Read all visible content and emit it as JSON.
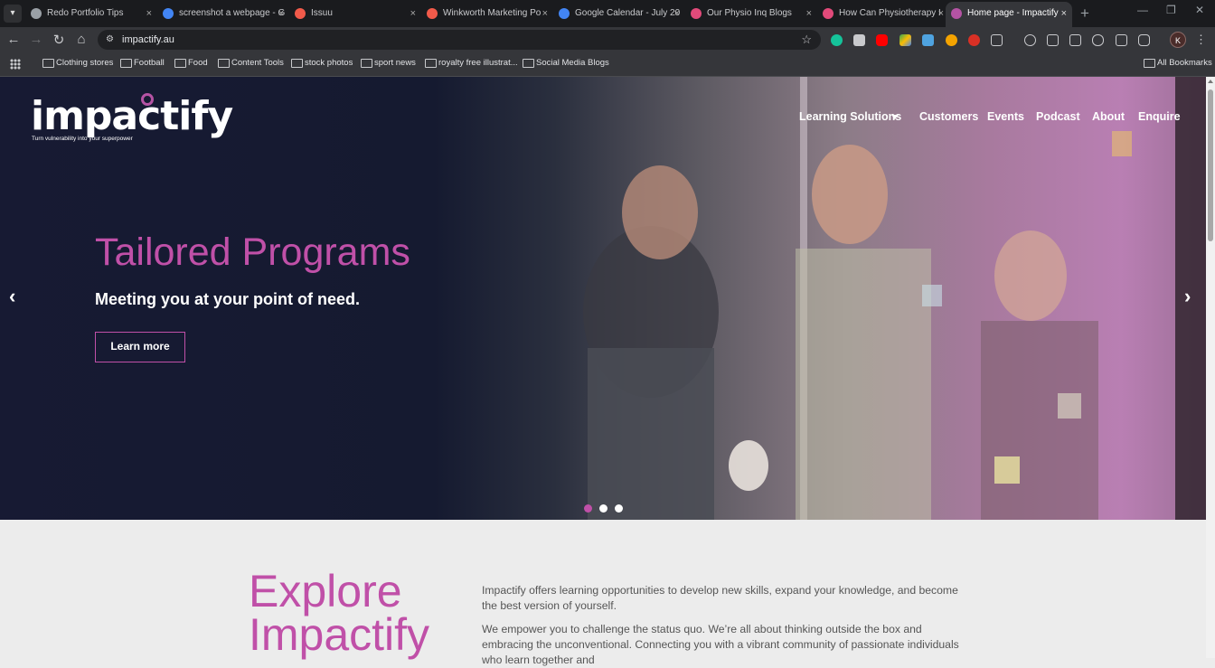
{
  "browser": {
    "tabs": [
      {
        "title": "Redo Portfolio Tips",
        "color": "#9aa0a6"
      },
      {
        "title": "screenshot a webpage - G",
        "color": "#4285f4"
      },
      {
        "title": "Issuu",
        "color": "#f15a4a"
      },
      {
        "title": "Winkworth Marketing Po",
        "color": "#f15a4a"
      },
      {
        "title": "Google Calendar - July 20",
        "color": "#4285f4"
      },
      {
        "title": "Our Physio Inq Blogs",
        "color": "#e24a7a"
      },
      {
        "title": "How Can Physiotherapy I",
        "color": "#e24a7a"
      },
      {
        "title": "Home page - Impactify",
        "color": "#b553a4"
      }
    ],
    "close_glyph": "×",
    "newtab_glyph": "+",
    "url": "impactify.au",
    "avatar_letter": "K",
    "bookmarks": [
      "Clothing stores",
      "Football",
      "Food",
      "Content Tools",
      "stock photos",
      "sport news",
      "royalty free illustrat...",
      "Social Media Blogs"
    ],
    "all_bookmarks": "All Bookmarks"
  },
  "site": {
    "logo": "impactify",
    "tagline": "Turn vulnerability into your superpower",
    "nav": [
      "Learning Solutions",
      "Customers",
      "Events",
      "Podcast",
      "About",
      "Enquire"
    ],
    "hero": {
      "headline": "Tailored Programs",
      "subline": "Meeting you at your point of need.",
      "cta": "Learn more",
      "prev": "‹",
      "next": "›",
      "slide_count": 3,
      "active_slide": 1
    },
    "explore": {
      "title": "Explore Impactify",
      "para1": "Impactify offers learning opportunities to develop new skills, expand your knowledge, and become the best version of yourself.",
      "para2": "We empower you to challenge the status quo. We’re all about thinking outside the box and embracing the unconventional. Connecting you with a vibrant community of passionate individuals who learn together and"
    },
    "accent": "#c050a8"
  }
}
